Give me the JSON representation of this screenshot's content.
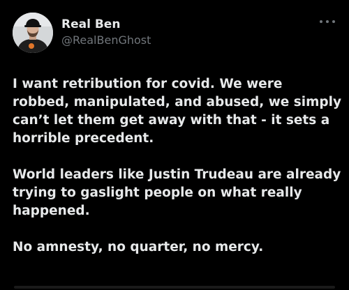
{
  "tweet": {
    "author": {
      "display_name": "Real Ben",
      "handle": "@RealBenGhost",
      "avatar_icon": "profile-photo"
    },
    "more_icon": "more-horizontal-icon",
    "paragraphs": [
      "I want retribution for covid. We were robbed, manipulated, and abused, we simply can’t let them get away with that - it sets a horrible precedent.",
      "World leaders like Justin Trudeau are already trying to gaslight people on what really happened.",
      "No amnesty, no quarter, no mercy."
    ]
  },
  "colors": {
    "background": "#000000",
    "text_primary": "#e7e9ea",
    "text_secondary": "#71767b"
  }
}
